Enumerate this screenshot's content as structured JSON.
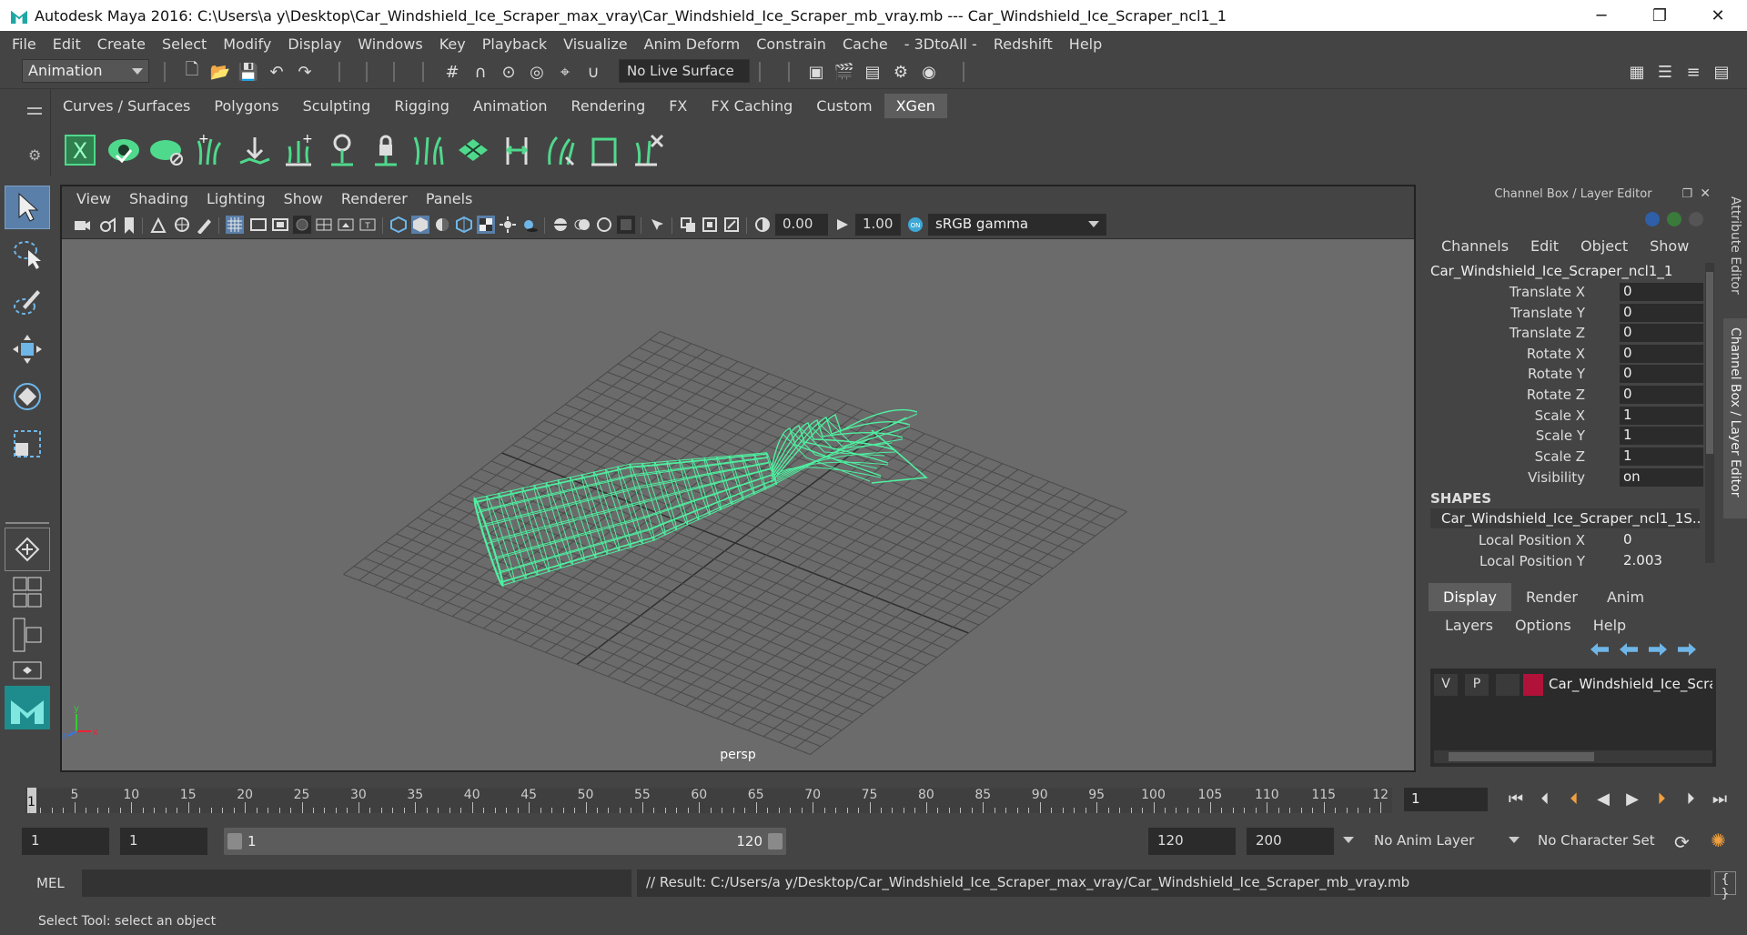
{
  "titlebar": {
    "title": "Autodesk Maya 2016: C:\\Users\\a y\\Desktop\\Car_Windshield_Ice_Scraper_max_vray\\Car_Windshield_Ice_Scraper_mb_vray.mb   ---   Car_Windshield_Ice_Scraper_ncl1_1",
    "minimize": "─",
    "maximize": "❐",
    "close": "✕"
  },
  "menubar": [
    "File",
    "Edit",
    "Create",
    "Select",
    "Modify",
    "Display",
    "Windows",
    "Key",
    "Playback",
    "Visualize",
    "Anim Deform",
    "Constrain",
    "Cache",
    "- 3DtoAll -",
    "Redshift",
    "Help"
  ],
  "statusline": {
    "mode": "Animation",
    "live_surface": "No Live Surface"
  },
  "shelf": {
    "tabs": [
      "Curves / Surfaces",
      "Polygons",
      "Sculpting",
      "Rigging",
      "Animation",
      "Rendering",
      "FX",
      "FX Caching",
      "Custom",
      "XGen"
    ],
    "active_tab": "XGen",
    "icon_color": "#4fd98c"
  },
  "viewport": {
    "menu": [
      "View",
      "Shading",
      "Lighting",
      "Show",
      "Renderer",
      "Panels"
    ],
    "near_value": "0.00",
    "gamma_value": "1.00",
    "color_space": "sRGB gamma",
    "camera_label": "persp",
    "background": "#6b6b6b",
    "wire_color": "#4ef0a0"
  },
  "channel_box": {
    "header": "Channel Box / Layer Editor",
    "menu": [
      "Channels",
      "Edit",
      "Object",
      "Show"
    ],
    "object_name": "Car_Windshield_Ice_Scraper_ncl1_1",
    "attributes": [
      {
        "label": "Translate X",
        "value": "0"
      },
      {
        "label": "Translate Y",
        "value": "0"
      },
      {
        "label": "Translate Z",
        "value": "0"
      },
      {
        "label": "Rotate X",
        "value": "0"
      },
      {
        "label": "Rotate Y",
        "value": "0"
      },
      {
        "label": "Rotate Z",
        "value": "0"
      },
      {
        "label": "Scale X",
        "value": "1"
      },
      {
        "label": "Scale Y",
        "value": "1"
      },
      {
        "label": "Scale Z",
        "value": "1"
      },
      {
        "label": "Visibility",
        "value": "on"
      }
    ],
    "shapes_label": "SHAPES",
    "shape_name": "Car_Windshield_Ice_Scraper_ncl1_1S...",
    "shape_attributes": [
      {
        "label": "Local Position X",
        "value": "0"
      },
      {
        "label": "Local Position Y",
        "value": "2.003"
      }
    ]
  },
  "layer_editor": {
    "tabs": [
      "Display",
      "Render",
      "Anim"
    ],
    "active_tab": "Display",
    "menu": [
      "Layers",
      "Options",
      "Help"
    ],
    "layer": {
      "v": "V",
      "p": "P",
      "name": "Car_Windshield_Ice_Scra",
      "color": "#b0123a"
    }
  },
  "side_tabs": {
    "attribute_editor": "Attribute Editor",
    "channel_box": "Channel Box / Layer Editor"
  },
  "timeline": {
    "ticks": [
      "5",
      "10",
      "15",
      "20",
      "25",
      "30",
      "35",
      "40",
      "45",
      "50",
      "55",
      "60",
      "65",
      "70",
      "75",
      "80",
      "85",
      "90",
      "95",
      "100",
      "105",
      "110",
      "115",
      "12"
    ],
    "start_label": "1",
    "current_frame": "1"
  },
  "range": {
    "start": "1",
    "playback_start": "1",
    "slider_start": "1",
    "slider_end": "120",
    "playback_end": "120",
    "end": "200",
    "anim_layer": "No Anim Layer",
    "character_set": "No Character Set"
  },
  "mel": {
    "label": "MEL",
    "result": "// Result: C:/Users/a y/Desktop/Car_Windshield_Ice_Scraper_max_vray/Car_Windshield_Ice_Scraper_mb_vray.mb"
  },
  "help_line": "Select Tool: select an object"
}
